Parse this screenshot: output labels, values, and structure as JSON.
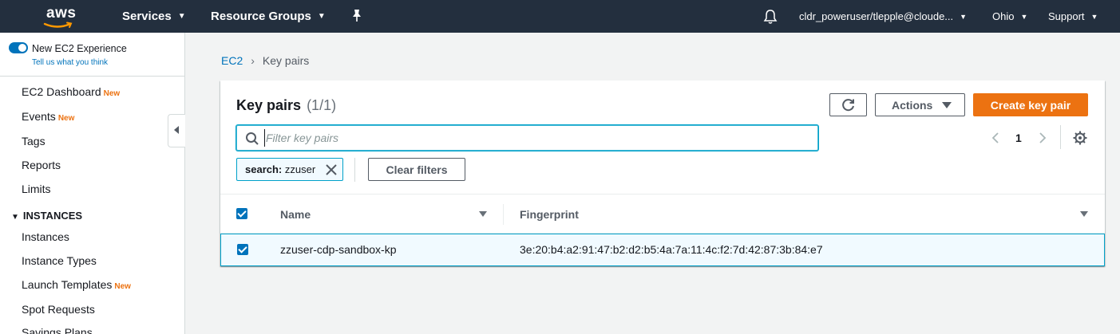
{
  "topnav": {
    "logo_text": "aws",
    "services_label": "Services",
    "resource_groups_label": "Resource Groups",
    "user_label": "cldr_poweruser/tlepple@cloude...",
    "region_label": "Ohio",
    "support_label": "Support"
  },
  "sidebar": {
    "new_experience_label": "New EC2 Experience",
    "tell_us_label": "Tell us what you think",
    "new_badge": "New",
    "items": [
      {
        "label": "EC2 Dashboard",
        "badge": "New"
      },
      {
        "label": "Events",
        "badge": "New"
      },
      {
        "label": "Tags"
      },
      {
        "label": "Reports"
      },
      {
        "label": "Limits"
      }
    ],
    "instances_section": "INSTANCES",
    "instance_items": [
      {
        "label": "Instances"
      },
      {
        "label": "Instance Types"
      },
      {
        "label": "Launch Templates",
        "badge": "New"
      },
      {
        "label": "Spot Requests"
      },
      {
        "label": "Savings Plans"
      }
    ]
  },
  "breadcrumb": {
    "root": "EC2",
    "current": "Key pairs"
  },
  "panel": {
    "title": "Key pairs",
    "count": "(1/1)",
    "actions_label": "Actions",
    "create_label": "Create key pair",
    "search_placeholder": "Filter key pairs",
    "page_number": "1",
    "token_key": "search:",
    "token_value": "zzuser",
    "clear_filters_label": "Clear filters",
    "columns": {
      "name": "Name",
      "fingerprint": "Fingerprint"
    },
    "rows": [
      {
        "name": "zzuser-cdp-sandbox-kp",
        "fingerprint": "3e:20:b4:a2:91:47:b2:d2:b5:4a:7a:11:4c:f2:7d:42:87:3b:84:e7",
        "selected": true
      }
    ]
  },
  "colors": {
    "nav_bg": "#232f3e",
    "accent_orange": "#ec7211",
    "link_blue": "#0073bb",
    "selection_border": "#00a1c9"
  },
  "icons": {
    "pin": "pin-icon",
    "bell": "bell-icon",
    "refresh": "refresh-icon",
    "search": "search-icon",
    "gear": "gear-icon",
    "close": "close-icon"
  }
}
